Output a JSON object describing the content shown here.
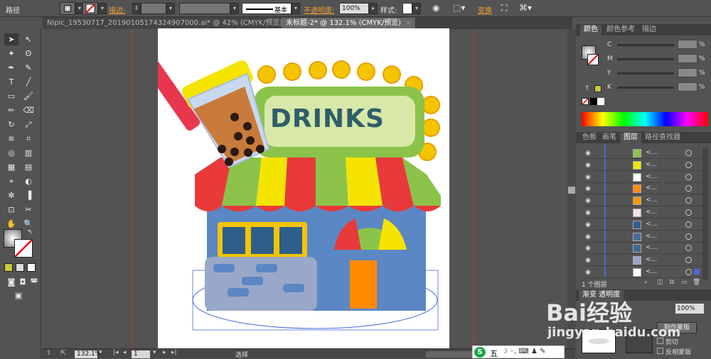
{
  "control_bar": {
    "object_type": "路径",
    "stroke_label": "描边:",
    "brush_label": "基本",
    "opacity_label": "不透明度:",
    "opacity_value": "100%",
    "style_label": "样式:",
    "transform_label": "变换"
  },
  "tabs": [
    {
      "label": "Nipic_19530717_20190105174324907000.ai* @ 42% (CMYK/预览)",
      "active": false
    },
    {
      "label": "未标题-2* @ 132.1% (CMYK/预览)",
      "active": true
    }
  ],
  "status_bar": {
    "zoom": "132.1%",
    "artboard_number": "1",
    "tool_name": "选择"
  },
  "color_panel": {
    "tabs": [
      "颜色",
      "颜色参考",
      "描边"
    ],
    "channels": [
      "C",
      "M",
      "Y",
      "K"
    ],
    "percent": "%"
  },
  "layers_panel": {
    "tabs": [
      "色板",
      "画笔",
      "图层",
      "路径查找器"
    ],
    "row_name": "<...",
    "thumb_colors": [
      "#8bc34a",
      "#f5e400",
      "#ffffff",
      "#ff8a00",
      "#ff9800",
      "#f0e6e6",
      "#2f5e8a",
      "#4a6a9a",
      "#3d6b94",
      "#99a8c8",
      "#ffffff"
    ],
    "footer": "1 个图层"
  },
  "transparency_panel": {
    "title": "渐变 透明度",
    "opacity_value": "100%",
    "make_mask_button": "制作蒙版",
    "clip_label": "剪切",
    "invert_label": "反相蒙版"
  },
  "artwork": {
    "sign_text": "DRINKS"
  },
  "ime_bar": {
    "mode_char": "五"
  },
  "watermark": {
    "brand": "Bai经验",
    "url": "jingyan.baidu.com"
  },
  "colors": {
    "selection_blue": "#4a6ad9",
    "guide_red": "#c0392b",
    "accent_orange": "#f0a030"
  }
}
